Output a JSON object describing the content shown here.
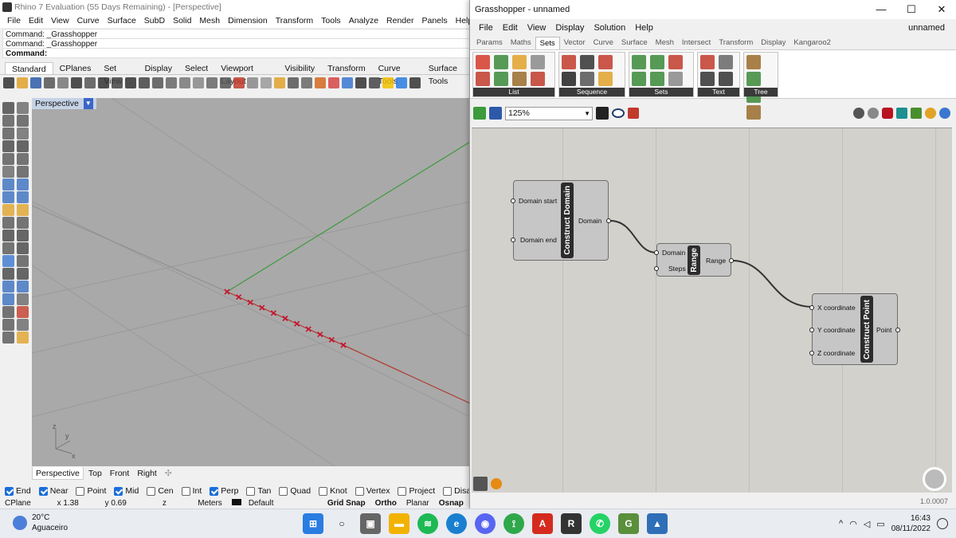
{
  "rhino": {
    "title": "Rhino 7 Evaluation (55 Days Remaining) - [Perspective]",
    "menu": [
      "File",
      "Edit",
      "View",
      "Curve",
      "Surface",
      "SubD",
      "Solid",
      "Mesh",
      "Dimension",
      "Transform",
      "Tools",
      "Analyze",
      "Render",
      "Panels",
      "Help"
    ],
    "command_history": [
      "Command: _Grasshopper",
      "Command: _Grasshopper"
    ],
    "command_prompt": "Command:",
    "toolbar_tabs": [
      "Standard",
      "CPlanes",
      "Set View",
      "Display",
      "Select",
      "Viewport Layout",
      "Visibility",
      "Transform",
      "Curve Tools",
      "Surface Tools"
    ],
    "active_toolbar_tab": "Standard",
    "viewport_label": "Perspective",
    "viewport_tabs": [
      "Perspective",
      "Top",
      "Front",
      "Right"
    ],
    "osnaps": [
      {
        "label": "End",
        "checked": true
      },
      {
        "label": "Near",
        "checked": true
      },
      {
        "label": "Point",
        "checked": false
      },
      {
        "label": "Mid",
        "checked": true
      },
      {
        "label": "Cen",
        "checked": false
      },
      {
        "label": "Int",
        "checked": false
      },
      {
        "label": "Perp",
        "checked": true
      },
      {
        "label": "Tan",
        "checked": false
      },
      {
        "label": "Quad",
        "checked": false
      },
      {
        "label": "Knot",
        "checked": false
      },
      {
        "label": "Vertex",
        "checked": false
      },
      {
        "label": "Project",
        "checked": false
      },
      {
        "label": "Disable",
        "checked": false
      }
    ],
    "status": {
      "cplane": "CPlane",
      "x": "x 1.38",
      "y": "y 0.69",
      "z": "z",
      "units": "Meters",
      "layer": "Default",
      "grid_snap": "Grid Snap",
      "ortho": "Ortho",
      "planar": "Planar",
      "osnap": "Osnap"
    },
    "axis_labels": {
      "z": "z",
      "y": "y",
      "x": "x"
    }
  },
  "grasshopper": {
    "title": "Grasshopper - unnamed",
    "doc_name": "unnamed",
    "menu": [
      "File",
      "Edit",
      "View",
      "Display",
      "Solution",
      "Help"
    ],
    "tabs": [
      "Params",
      "Maths",
      "Sets",
      "Vector",
      "Curve",
      "Surface",
      "Mesh",
      "Intersect",
      "Transform",
      "Display",
      "Kangaroo2"
    ],
    "active_tab": "Sets",
    "ribbon_groups": [
      "List",
      "Sequence",
      "Sets",
      "Text",
      "Tree"
    ],
    "zoom": "125%",
    "version": "1.0.0007",
    "components": {
      "construct_domain": {
        "name": "Construct Domain",
        "inputs": [
          "Domain start",
          "Domain end"
        ],
        "outputs": [
          "Domain"
        ]
      },
      "range": {
        "name": "Range",
        "inputs": [
          "Domain",
          "Steps"
        ],
        "outputs": [
          "Range"
        ]
      },
      "construct_point": {
        "name": "Construct Point",
        "inputs": [
          "X coordinate",
          "Y coordinate",
          "Z coordinate"
        ],
        "outputs": [
          "Point"
        ]
      }
    }
  },
  "taskbar": {
    "temperature": "20°C",
    "weather": "Aguaceiro",
    "time": "16:43",
    "date": "08/11/2022"
  },
  "colors": {
    "viewport_bg": "#a9a9a9",
    "gh_canvas": "#d2d1cc",
    "component_fill": "#c6c6c6",
    "x_axis": "#b03a2e",
    "y_axis": "#3d9a3d",
    "point_marker": "#c8102e"
  }
}
